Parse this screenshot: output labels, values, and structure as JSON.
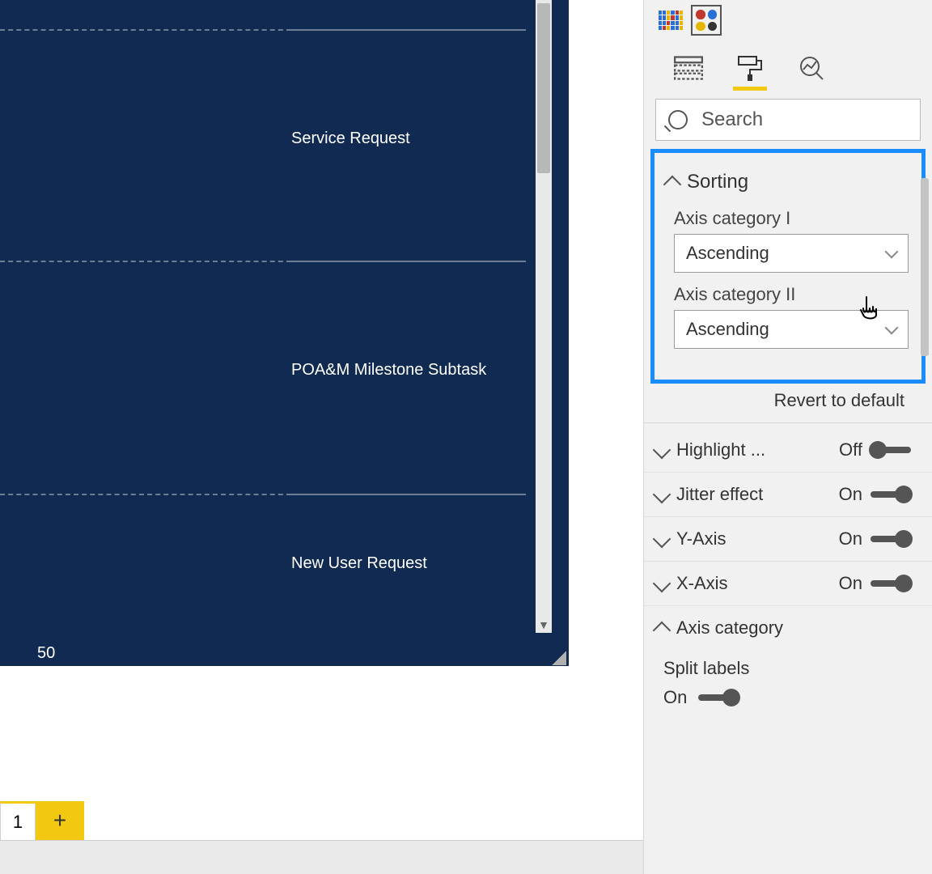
{
  "canvas": {
    "rows": [
      {
        "label": "Service Request"
      },
      {
        "label": "POA&M Milestone Subtask"
      },
      {
        "label": "New User Request"
      }
    ],
    "x_tick": "50"
  },
  "tabs": {
    "page_label": "1",
    "add_label": "+"
  },
  "search": {
    "placeholder": "Search"
  },
  "sorting": {
    "title": "Sorting",
    "axis1_label": "Axis category I",
    "axis1_value": "Ascending",
    "axis2_label": "Axis category II",
    "axis2_value": "Ascending",
    "revert": "Revert to default"
  },
  "rows": {
    "highlight": {
      "label": "Highlight ...",
      "state": "Off",
      "on": false
    },
    "jitter": {
      "label": "Jitter effect",
      "state": "On",
      "on": true
    },
    "yaxis": {
      "label": "Y-Axis",
      "state": "On",
      "on": true
    },
    "xaxis": {
      "label": "X-Axis",
      "state": "On",
      "on": true
    },
    "axiscat": {
      "label": "Axis category"
    },
    "split": {
      "label": "Split labels",
      "state": "On",
      "on": true
    }
  }
}
